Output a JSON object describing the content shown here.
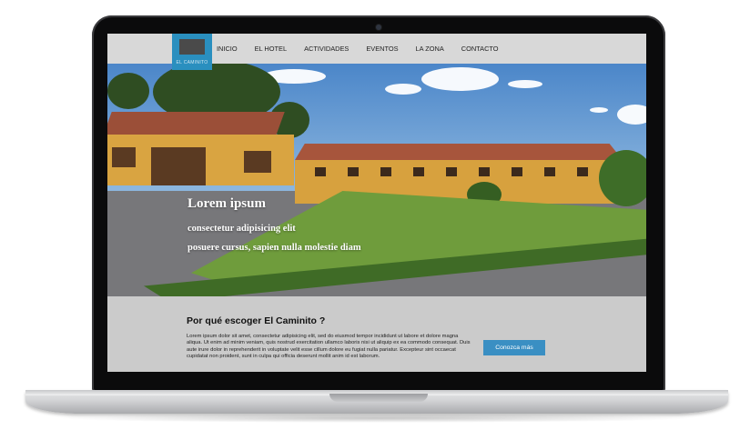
{
  "site": {
    "logo_text": "EL CAMINITO",
    "nav": [
      "INICIO",
      "EL HOTEL",
      "ACTIVIDADES",
      "EVENTOS",
      "LA ZONA",
      "CONTACTO"
    ],
    "hero": {
      "title": "Lorem ipsum",
      "subtitle_line1": "consectetur adipisicing elit",
      "subtitle_line2": "posuere cursus, sapien nulla molestie diam"
    },
    "section": {
      "title": "Por qué escoger El Caminito ?",
      "body": "Lorem ipsum dolor sit amet, consectetur adipisicing elit, sed do eiusmod tempor incididunt ut labore et dolore magna aliqua. Ut enim ad minim veniam, quis nostrud exercitation ullamco laboris nisi ut aliquip ex ea commodo consequat. Duis aute irure dolor in reprehenderit in voluptate velit esse cillum dolore eu fugiat nulla pariatur. Excepteur sint occaecat cupidatat non proident, sunt in culpa qui officia deserunt mollit anim id est laborum.",
      "button": "Conozca más"
    }
  },
  "colors": {
    "accent": "#2a8fbf",
    "button": "#3a8fc3",
    "nav_bg": "#d8d8d8",
    "content_bg": "#cbcbcb"
  }
}
